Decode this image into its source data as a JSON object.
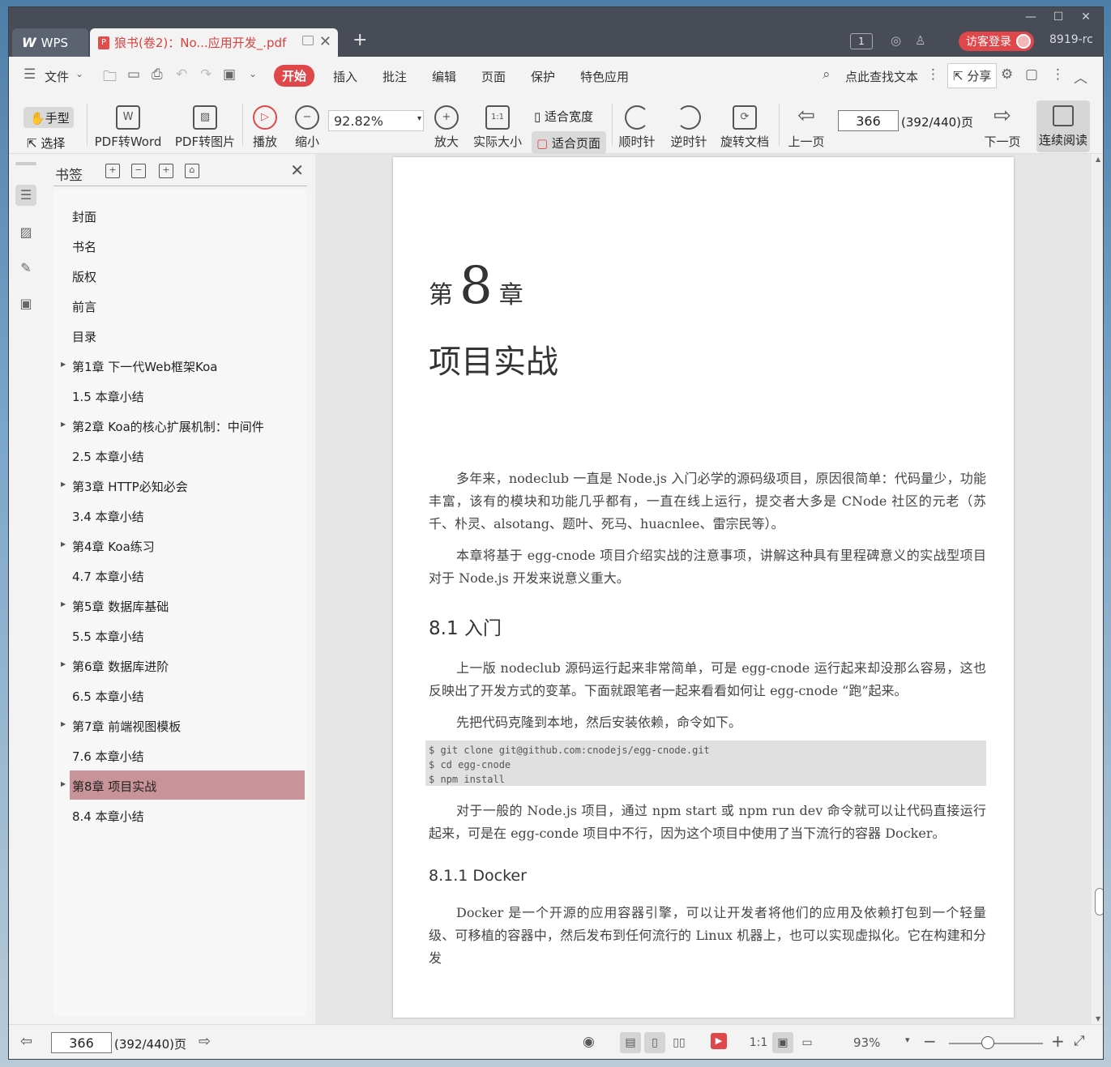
{
  "titlebar": {
    "app_tab": "WPS",
    "doc_tab": "狼书(卷2)：No...应用开发_.pdf",
    "page_count_badge": "1",
    "visitor_login": "访客登录",
    "user": "8919-rc"
  },
  "menu": {
    "file": "文件",
    "tabs": [
      "开始",
      "插入",
      "批注",
      "编辑",
      "页面",
      "保护",
      "特色应用"
    ],
    "search": "点此查找文本",
    "share": "分享"
  },
  "toolbar": {
    "hand": "手型",
    "select": "选择",
    "pdf_to_word": "PDF转Word",
    "pdf_to_image": "PDF转图片",
    "play": "播放",
    "zoom_out": "缩小",
    "zoom_value": "92.82%",
    "zoom_in": "放大",
    "actual_size": "实际大小",
    "fit_width": "适合宽度",
    "fit_page": "适合页面",
    "clockwise": "顺时针",
    "counterclockwise": "逆时针",
    "rotate_doc": "旋转文档",
    "prev_page": "上一页",
    "page_value": "366",
    "page_total": "(392/440)页",
    "next_page": "下一页",
    "continuous": "连续阅读"
  },
  "bookmarks": {
    "title": "书签",
    "items": [
      {
        "label": "封面",
        "expandable": false
      },
      {
        "label": "书名",
        "expandable": false
      },
      {
        "label": "版权",
        "expandable": false
      },
      {
        "label": "前言",
        "expandable": false
      },
      {
        "label": "目录",
        "expandable": false
      },
      {
        "label": "第1章  下一代Web框架Koa",
        "expandable": true
      },
      {
        "label": "1.5  本章小结",
        "expandable": false
      },
      {
        "label": "第2章  Koa的核心扩展机制：中间件",
        "expandable": true
      },
      {
        "label": "2.5  本章小结",
        "expandable": false
      },
      {
        "label": "第3章  HTTP必知必会",
        "expandable": true
      },
      {
        "label": "3.4  本章小结",
        "expandable": false
      },
      {
        "label": "第4章  Koa练习",
        "expandable": true
      },
      {
        "label": "4.7  本章小结",
        "expandable": false
      },
      {
        "label": "第5章  数据库基础",
        "expandable": true
      },
      {
        "label": "5.5  本章小结",
        "expandable": false
      },
      {
        "label": "第6章  数据库进阶",
        "expandable": true
      },
      {
        "label": "6.5  本章小结",
        "expandable": false
      },
      {
        "label": "第7章  前端视图模板",
        "expandable": true
      },
      {
        "label": "7.6  本章小结",
        "expandable": false
      },
      {
        "label": "第8章  项目实战",
        "expandable": true,
        "selected": true
      },
      {
        "label": "8.4  本章小结",
        "expandable": false
      }
    ]
  },
  "document": {
    "chapter_prefix": "第",
    "chapter_num": "8",
    "chapter_suffix": "章",
    "chapter_title": "项目实战",
    "para1": "多年来，nodeclub 一直是 Node.js 入门必学的源码级项目，原因很简单：代码量少，功能丰富，该有的模块和功能几乎都有，一直在线上运行，提交者大多是 CNode 社区的元老（苏千、朴灵、alsotang、题叶、死马、huacnlee、雷宗民等）。",
    "para2": "本章将基于 egg-cnode 项目介绍实战的注意事项，讲解这种具有里程碑意义的实战型项目对于 Node.js 开发来说意义重大。",
    "h_8_1": "8.1   入门",
    "para3": "上一版 nodeclub 源码运行起来非常简单，可是 egg-cnode 运行起来却没那么容易，这也反映出了开发方式的变革。下面就跟笔者一起来看看如何让 egg-cnode “跑”起来。",
    "para4": "先把代码克隆到本地，然后安装依赖，命令如下。",
    "code": [
      "$ git clone git@github.com:cnodejs/egg-cnode.git",
      "$ cd egg-cnode",
      "$ npm install"
    ],
    "para5": "对于一般的 Node.js 项目，通过 npm start 或 npm run dev 命令就可以让代码直接运行起来，可是在 egg-conde 项目中不行，因为这个项目中使用了当下流行的容器 Docker。",
    "h_8_1_1": "8.1.1   Docker",
    "para6": "Docker 是一个开源的应用容器引擎，可以让开发者将他们的应用及依赖打包到一个轻量级、可移植的容器中，然后发布到任何流行的 Linux 机器上，也可以实现虚拟化。它在构建和分发"
  },
  "statusbar": {
    "page_value": "366",
    "page_total": "(392/440)页",
    "zoom": "93%"
  }
}
